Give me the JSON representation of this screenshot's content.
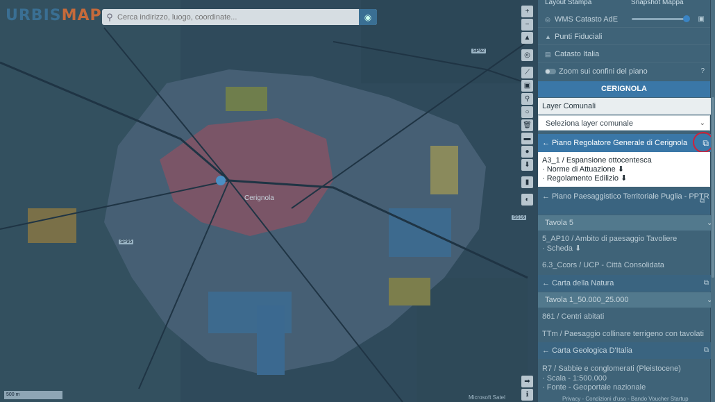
{
  "app": {
    "logo_part1": "URBIS",
    "logo_part2": "MAP"
  },
  "search": {
    "placeholder": "Cerca indirizzo, luogo, coordinate..."
  },
  "map": {
    "road_labels": [
      "SP62",
      "SS16",
      "SP95"
    ],
    "city_label": "Cerignola",
    "scale_text": "500 m",
    "attribution": "Microsoft Satel"
  },
  "toolbar": {
    "icons": [
      "zoom-in-icon",
      "zoom-out-icon",
      "compass-icon",
      "locate-icon",
      "ruler-icon",
      "area-icon",
      "marker-icon",
      "circle-icon",
      "trash-icon",
      "print-icon",
      "pin-icon",
      "download-icon",
      "bookmark-icon",
      "globe-icon",
      "arrow-right-icon",
      "info-icon"
    ]
  },
  "panel": {
    "top_tabs": [
      "Layout Stampa",
      "Snapshot Mappa"
    ],
    "menu": [
      {
        "label": "WMS Catasto AdE",
        "icon": "globe-icon"
      },
      {
        "label": "Punti Fiduciali",
        "icon": "triangle-icon"
      },
      {
        "label": "Catasto Italia",
        "icon": "building-icon"
      },
      {
        "label": "Zoom sui confini del piano",
        "icon": "toggle-icon"
      }
    ],
    "comune": {
      "title": "CERIGNOLA",
      "layer_label": "Layer Comunali",
      "select_value": "Seleziona layer comunale"
    },
    "prg": {
      "title": "← Piano Regolatore Generale di Cerignola",
      "zone": "A3_1 / Espansione ottocentesca",
      "links": [
        "· Norme di Attuazione ⬇",
        "· Regolamento Edilizio ⬇"
      ]
    },
    "pptr": {
      "title": "← Piano Paesaggistico Territoriale Puglia - PPTR",
      "select_value": "Tavola 5",
      "line1": "5_AP10 / Ambito di paesaggio Tavoliere",
      "line2": "· Scheda ⬇",
      "line3": "6.3_Ccors / UCP - Città Consolidata"
    },
    "natura": {
      "title": "← Carta della Natura",
      "select_value": "Tavola 1_50.000_25.000",
      "line1": "861 / Centri abitati",
      "line2": "TTm / Paesaggio collinare terrigeno con tavolati"
    },
    "geologica": {
      "title": "← Carta Geologica D'Italia",
      "line1": "R7 / Sabbie e conglomerati (Pleistocene)",
      "line2": "· Scala - 1:500.000",
      "line3": "· Fonte - Geoportale nazionale"
    },
    "footer": "Privacy - Condizioni d'uso - Bando Voucher Startup"
  }
}
